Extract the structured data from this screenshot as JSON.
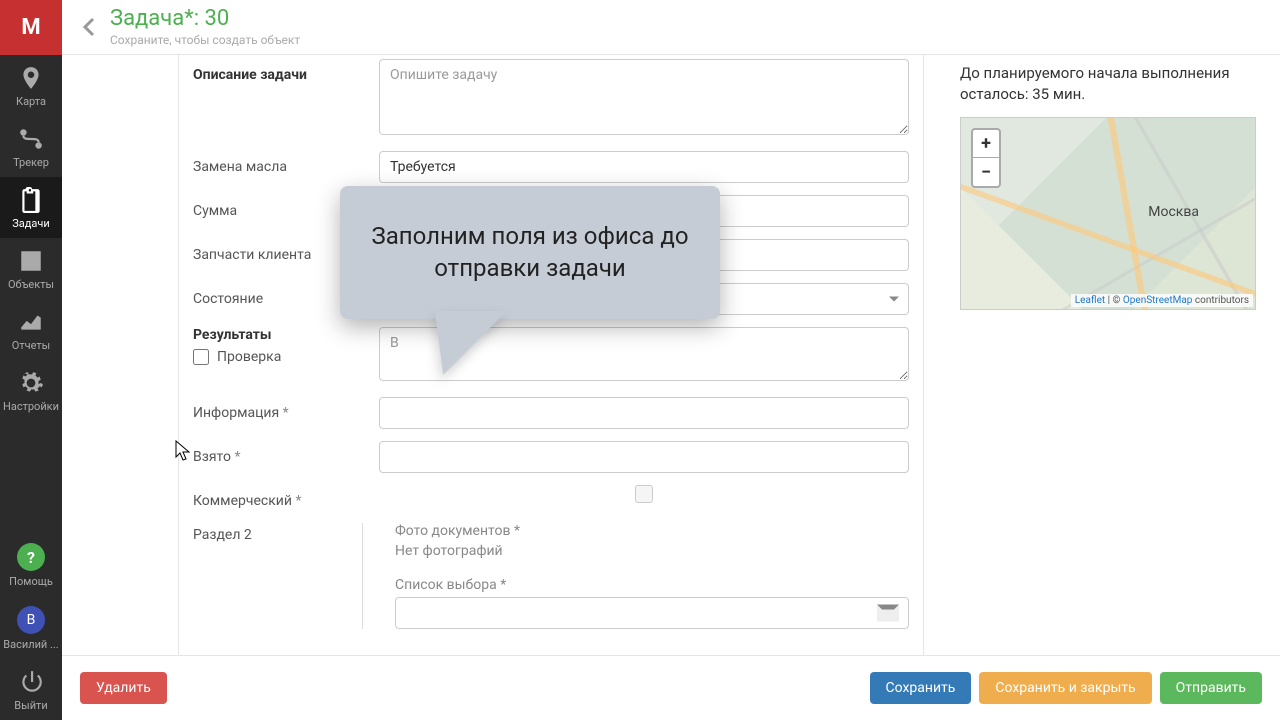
{
  "sidebar": {
    "logo": "М",
    "items": [
      {
        "label": "Карта",
        "icon": "pin"
      },
      {
        "label": "Трекер",
        "icon": "route"
      },
      {
        "label": "Задачи",
        "icon": "clipboard",
        "active": true
      },
      {
        "label": "Объекты",
        "icon": "building"
      },
      {
        "label": "Отчеты",
        "icon": "chart"
      },
      {
        "label": "Настройки",
        "icon": "gear"
      }
    ],
    "help_label": "Помощь",
    "help_badge": "?",
    "user_initial": "В",
    "user_label": "Василий ...",
    "exit_label": "Выйти"
  },
  "header": {
    "title_prefix": "Задача",
    "title_star": "*",
    "title_sep": ": ",
    "title_id": "30",
    "subtitle": "Сохраните, чтобы создать объект"
  },
  "form": {
    "description_label": "Описание задачи",
    "description_placeholder": "Опишите задачу",
    "oil_label": "Замена масла",
    "oil_value": "Требуется",
    "sum_label": "Сумма",
    "parts_label": "Запчасти клиента",
    "state_label": "Состояние",
    "results_label": "Результаты",
    "check_label": "Проверка",
    "results_placeholder": "В",
    "info_label": "Информация",
    "taken_label": "Взято",
    "commercial_label": "Коммерческий",
    "section2_label": "Раздел 2",
    "photos_label": "Фото документов",
    "photos_empty": "Нет фотографий",
    "choicelist_label": "Список выбора",
    "req": "*"
  },
  "right": {
    "countdown": "До планируемого начала выполнения осталось: 35 мин.",
    "city": "Москва",
    "zoom_in": "+",
    "zoom_out": "−",
    "attr_leaflet": "Leaflet",
    "attr_sep": " | © ",
    "attr_osm": "OpenStreetMap",
    "attr_tail": " contributors"
  },
  "footer": {
    "delete": "Удалить",
    "save": "Сохранить",
    "save_close": "Сохранить и закрыть",
    "send": "Отправить"
  },
  "tooltip": {
    "text": "Заполним поля из офиса до отправки задачи"
  }
}
